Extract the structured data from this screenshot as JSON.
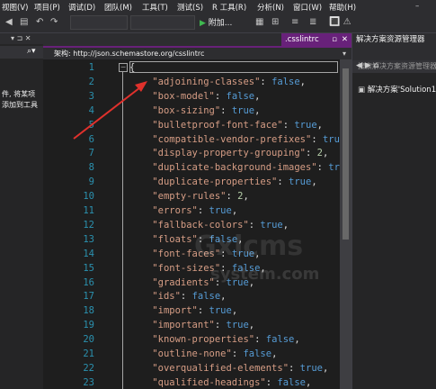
{
  "menu": [
    "视图(V)",
    "项目(P)",
    "调试(D)",
    "团队(M)",
    "工具(T)",
    "测试(S)",
    "R 工具(R)",
    "分析(N)",
    "窗口(W)",
    "帮助(H)"
  ],
  "toolbar": {
    "run_label": "附加...",
    "window_controls": "🔳 ⚠"
  },
  "left_panel": {
    "line1": "件, 将某项",
    "line2": "添加到工具"
  },
  "editor": {
    "tab_label": ".csslintrc",
    "tab_close": "✕",
    "schema_label": "架构: http://json.schemastore.org/csslintrc",
    "open_brace": "{",
    "lines": [
      {
        "num": "1",
        "key": "",
        "value": "",
        "vtype": ""
      },
      {
        "num": "2",
        "key": "\"adjoining-classes\"",
        "value": "false",
        "vtype": "v"
      },
      {
        "num": "3",
        "key": "\"box-model\"",
        "value": "false",
        "vtype": "v"
      },
      {
        "num": "4",
        "key": "\"box-sizing\"",
        "value": "true",
        "vtype": "v"
      },
      {
        "num": "5",
        "key": "\"bulletproof-font-face\"",
        "value": "true",
        "vtype": "v"
      },
      {
        "num": "6",
        "key": "\"compatible-vendor-prefixes\"",
        "value": "true",
        "vtype": "v"
      },
      {
        "num": "7",
        "key": "\"display-property-grouping\"",
        "value": "2",
        "vtype": "n"
      },
      {
        "num": "8",
        "key": "\"duplicate-background-images\"",
        "value": "true",
        "vtype": "v"
      },
      {
        "num": "9",
        "key": "\"duplicate-properties\"",
        "value": "true",
        "vtype": "v"
      },
      {
        "num": "10",
        "key": "\"empty-rules\"",
        "value": "2",
        "vtype": "n"
      },
      {
        "num": "11",
        "key": "\"errors\"",
        "value": "true",
        "vtype": "v"
      },
      {
        "num": "12",
        "key": "\"fallback-colors\"",
        "value": "true",
        "vtype": "v"
      },
      {
        "num": "13",
        "key": "\"floats\"",
        "value": "false",
        "vtype": "v"
      },
      {
        "num": "14",
        "key": "\"font-faces\"",
        "value": "true",
        "vtype": "v"
      },
      {
        "num": "15",
        "key": "\"font-sizes\"",
        "value": "false",
        "vtype": "v"
      },
      {
        "num": "16",
        "key": "\"gradients\"",
        "value": "true",
        "vtype": "v"
      },
      {
        "num": "17",
        "key": "\"ids\"",
        "value": "false",
        "vtype": "v"
      },
      {
        "num": "18",
        "key": "\"import\"",
        "value": "true",
        "vtype": "v"
      },
      {
        "num": "19",
        "key": "\"important\"",
        "value": "true",
        "vtype": "v"
      },
      {
        "num": "20",
        "key": "\"known-properties\"",
        "value": "false",
        "vtype": "v"
      },
      {
        "num": "21",
        "key": "\"outline-none\"",
        "value": "false",
        "vtype": "v"
      },
      {
        "num": "22",
        "key": "\"overqualified-elements\"",
        "value": "true",
        "vtype": "v"
      },
      {
        "num": "23",
        "key": "\"qualified-headings\"",
        "value": "false",
        "vtype": "v"
      }
    ]
  },
  "solution_explorer": {
    "title": "解决方案资源管理器",
    "search_placeholder": "搜索解决方案资源管理器",
    "item": "解决方案'Solution1"
  },
  "watermark": {
    "line1": "Gxlcms",
    "line2": "system.com"
  },
  "colors": {
    "accent": "#68217a",
    "line_number": "#2b91af",
    "string": "#d69d85",
    "keyword": "#569cd6",
    "arrow": "#e0312c"
  }
}
